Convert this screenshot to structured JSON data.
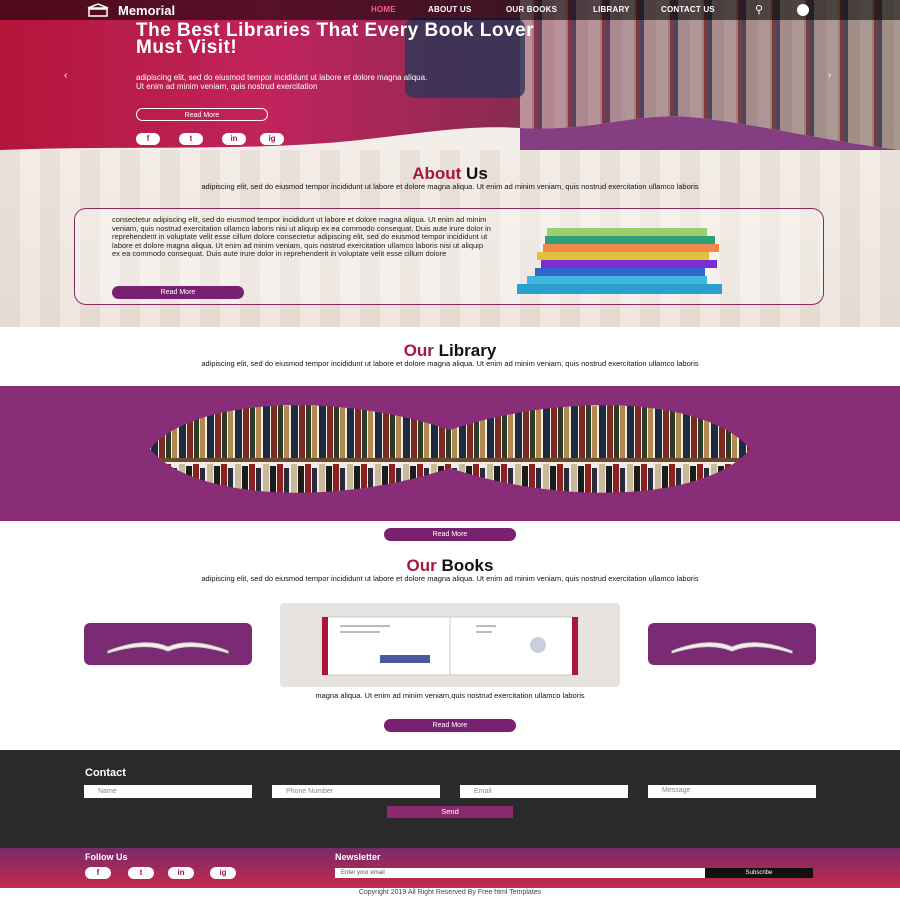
{
  "brand": {
    "name": "Memorial",
    "accent": "#a8183e",
    "purple": "#7a2070"
  },
  "nav": {
    "items": [
      "HOME",
      "ABOUT US",
      "OUR BOOKS",
      "LIBRARY",
      "CONTACT US"
    ],
    "search_icon": "search-icon",
    "user_icon": "user-icon"
  },
  "hero": {
    "title": "The Best Libraries That Every Book Lover Must Visit!",
    "text": "adipiscing elit, sed do eiusmod tempor incididunt ut labore et dolore magna aliqua. Ut enim ad minim veniam, quis nostrud exercitation",
    "button": "Read More",
    "social": [
      "f",
      "t",
      "in",
      "ig"
    ]
  },
  "about": {
    "title_a": "About",
    "title_b": "Us",
    "sub": "adipiscing elit, sed do eiusmod tempor incididunt ut labore et dolore magna aliqua. Ut enim ad minim veniam, quis nostrud exercitation ullamco laboris",
    "para": "consectetur adipiscing elit, sed do eiusmod tempor incididunt ut labore et dolore magna aliqua. Ut enim ad minim veniam, quis nostrud exercitation ullamco laboris nisi ut aliquip ex ea commodo consequat. Duis aute irure dolor in reprehenderit in voluptate velit esse cillum dolore consectetur adipiscing elit, sed do eiusmod tempor incididunt ut labore et dolore magna aliqua. Ut enim ad minim veniam, quis nostrud exercitation ullamco laboris nisi ut aliquip ex ea commodo consequat. Duis aute irure dolor in reprehenderit in voluptate velit esse cillum dolore",
    "button": "Read More"
  },
  "library": {
    "title_a": "Our",
    "title_b": "Library",
    "sub": "adipiscing elit, sed do eiusmod tempor incididunt ut labore et dolore magna aliqua. Ut enim ad minim veniam, quis nostrud exercitation ullamco laboris",
    "button": "Read More"
  },
  "books": {
    "title_a": "Our",
    "title_b": "Books",
    "sub": "adipiscing elit, sed do eiusmod tempor incididunt ut labore et dolore magna aliqua. Ut enim ad minim veniam, quis nostrud exercitation ullamco laboris",
    "caption": "magna aliqua. Ut enim ad minim veniam,quis nostrud exercitation ullamco laboris",
    "button": "Read More"
  },
  "contact": {
    "title": "Contact",
    "name_placeholder": "Name",
    "phone_placeholder": "Phone Number",
    "email_placeholder": "Email",
    "message_placeholder": "Message",
    "send": "Send"
  },
  "footer": {
    "follow": "Follow Us",
    "newsletter": "Newsletter",
    "news_placeholder": "Enter your email",
    "subscribe": "Subscribe",
    "copyright": "Copyright 2019 All Right Reserved By Free html Templates"
  }
}
